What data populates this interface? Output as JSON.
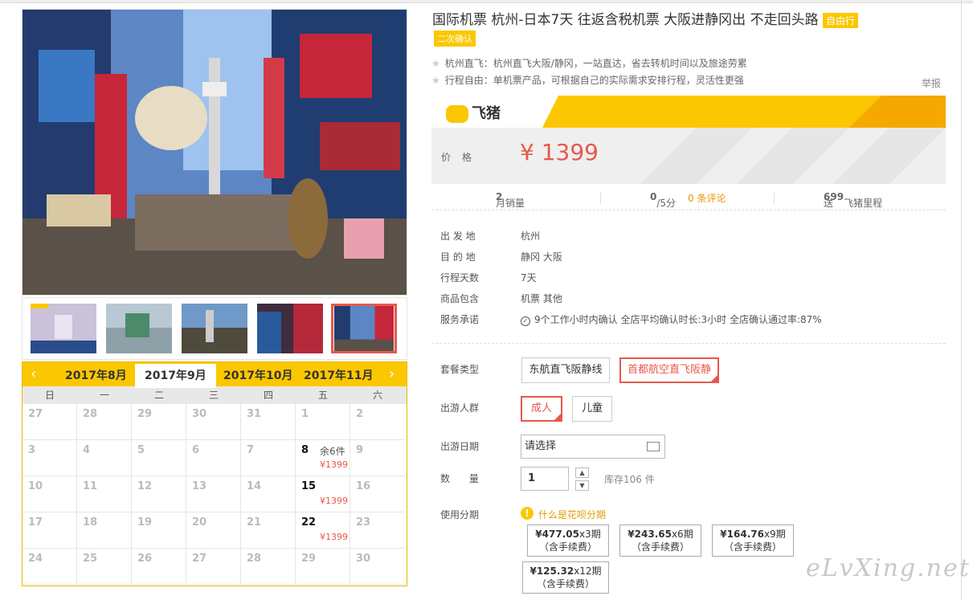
{
  "product": {
    "title": "国际机票 杭州-日本7天 往返含税机票 大阪进静冈出 不走回头路",
    "tag_free": "自由行",
    "tag_confirm": "二次确认",
    "features": [
      "杭州直飞：杭州直飞大阪/静冈，一站直达，省去转机时间以及旅途劳累",
      "行程自由：单机票产品，可根据自己的实际需求安排行程，灵活性更强"
    ],
    "report": "举报"
  },
  "brand": {
    "name": "飞猪"
  },
  "price": {
    "label": "价格",
    "value": "¥ 1399"
  },
  "stats": {
    "monthly_sales_label": "月销量",
    "monthly_sales_value": "2",
    "rating_value": "0",
    "rating_suffix": "/5分",
    "reviews": "0 条评论",
    "miles_prefix": "送",
    "miles_value": "699",
    "miles_suffix": "飞猪里程"
  },
  "details": [
    {
      "label": "出 发 地",
      "value": "杭州"
    },
    {
      "label": "目 的 地",
      "value": "静冈 大阪"
    },
    {
      "label": "行程天数",
      "value": "7天"
    },
    {
      "label": "商品包含",
      "value": "机票 其他"
    },
    {
      "label": "服务承诺",
      "value": "9个工作小时内确认 全店平均确认时长:3小时 全店确认通过率:87%"
    }
  ],
  "options": {
    "package_label": "套餐类型",
    "packages": [
      "东航直飞阪静线",
      "首都航空直飞阪静"
    ],
    "people_label": "出游人群",
    "people": [
      "成人",
      "儿童"
    ],
    "date_label": "出游日期",
    "date_placeholder": "请选择",
    "qty_label": "数 量",
    "qty_value": "1",
    "stock": "库存106 件",
    "installment_label": "使用分期",
    "installment_link": "什么是花呗分期",
    "installments": [
      {
        "amount": "¥477.05",
        "period": "x3期",
        "fee": "（含手续费）"
      },
      {
        "amount": "¥243.65",
        "period": "x6期",
        "fee": "（含手续费）"
      },
      {
        "amount": "¥164.76",
        "period": "x9期",
        "fee": "（含手续费）"
      },
      {
        "amount": "¥125.32",
        "period": "x12期",
        "fee": "（含手续费）"
      }
    ]
  },
  "calendar": {
    "months": [
      "2017年8月",
      "2017年9月",
      "2017年10月",
      "2017年11月"
    ],
    "weekdays": [
      "日",
      "一",
      "二",
      "三",
      "四",
      "五",
      "六"
    ],
    "days": [
      {
        "d": "27"
      },
      {
        "d": "28"
      },
      {
        "d": "29"
      },
      {
        "d": "30"
      },
      {
        "d": "31"
      },
      {
        "d": "1"
      },
      {
        "d": "2"
      },
      {
        "d": "3"
      },
      {
        "d": "4"
      },
      {
        "d": "5"
      },
      {
        "d": "6"
      },
      {
        "d": "7"
      },
      {
        "d": "8",
        "rem": "余6件",
        "price": "¥1399"
      },
      {
        "d": "9"
      },
      {
        "d": "10"
      },
      {
        "d": "11"
      },
      {
        "d": "12"
      },
      {
        "d": "13"
      },
      {
        "d": "14"
      },
      {
        "d": "15",
        "price": "¥1399"
      },
      {
        "d": "16"
      },
      {
        "d": "17"
      },
      {
        "d": "18"
      },
      {
        "d": "19"
      },
      {
        "d": "20"
      },
      {
        "d": "21"
      },
      {
        "d": "22",
        "price": "¥1399"
      },
      {
        "d": "23"
      },
      {
        "d": "24"
      },
      {
        "d": "25"
      },
      {
        "d": "26"
      },
      {
        "d": "27"
      },
      {
        "d": "28"
      },
      {
        "d": "29"
      },
      {
        "d": "30"
      }
    ]
  },
  "watermark": "eLvXing.net",
  "colors": {
    "accent": "#fbc700",
    "price": "#e8584c"
  }
}
